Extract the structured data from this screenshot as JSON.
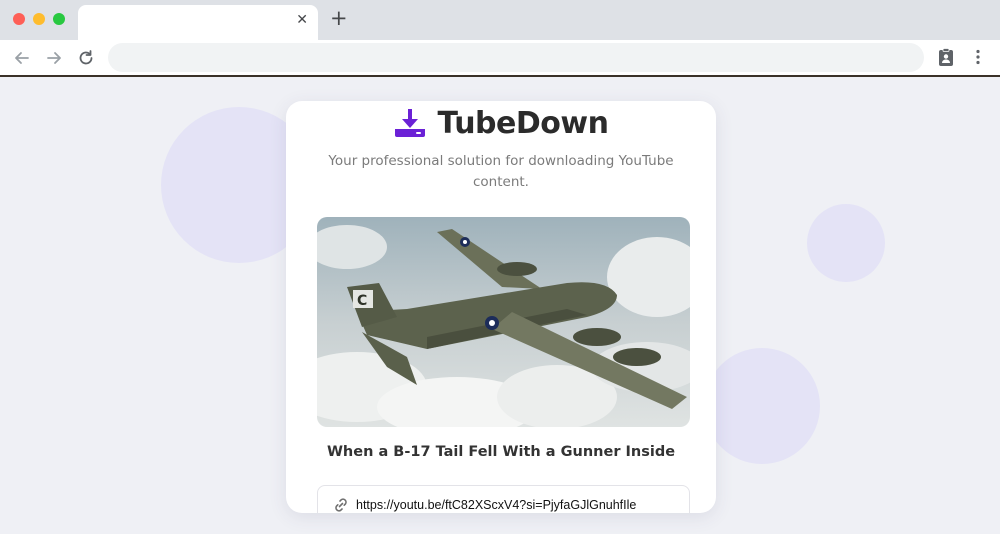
{
  "browser": {
    "tab": {
      "title": "",
      "close_glyph": "✕"
    },
    "new_tab_glyph": "+",
    "address_bar": {
      "value": ""
    },
    "icons": [
      "back-arrow-icon",
      "forward-arrow-icon",
      "reload-icon",
      "clipboard-account-icon",
      "kebab-menu-icon"
    ]
  },
  "app": {
    "brand": {
      "name": "TubeDown",
      "icon": "download-tray-icon",
      "accent_color": "#6b21d6"
    },
    "tagline": "Your professional solution for downloading YouTube content.",
    "video": {
      "thumbnail_icon": "b17-bomber-thumbnail",
      "title": "When a B-17 Tail Fell With a Gunner Inside"
    },
    "url_field": {
      "icon": "link-icon",
      "value": "https://youtu.be/ftC82XScxV4?si=PjyfaGJlGnuhfIle"
    }
  },
  "colors": {
    "page_background": "#eff0f5",
    "blob": "#e4e3f6",
    "card_background": "#ffffff",
    "title_text": "#2b2b2b"
  }
}
